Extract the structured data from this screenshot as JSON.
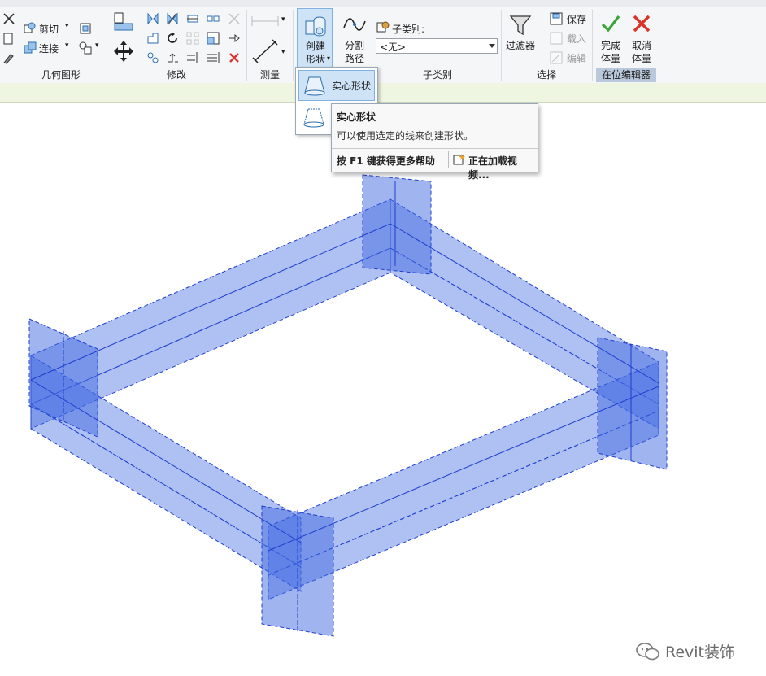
{
  "ribbon": {
    "geometry": {
      "cut_label": "剪切",
      "join_label": "连接",
      "panel_label": "几何图形"
    },
    "modify": {
      "panel_label": "修改"
    },
    "measure": {
      "panel_label": "测量"
    },
    "create": {
      "create_shape_label_line1": "创建",
      "create_shape_label_line2": "形状",
      "split_path_label_line1": "分割",
      "split_path_label_line2": "路径"
    },
    "subcategory": {
      "field_label": "子类别:",
      "selected_value": "<无>",
      "panel_label": "子类别"
    },
    "select": {
      "filter_label": "过滤器",
      "panel_label": "选择"
    },
    "family": {
      "save_label": "保存",
      "load_label": "载入",
      "edit_label": "编辑"
    },
    "in_place_editor": {
      "finish_label_line1": "完成",
      "finish_label_line2": "体量",
      "cancel_label_line1": "取消",
      "cancel_label_line2": "体量",
      "panel_label": "在位编辑器"
    }
  },
  "dropdown": {
    "solid_form_label": "实心形状",
    "void_form_label": "空"
  },
  "tooltip": {
    "title": "实心形状",
    "description": "可以使用选定的线来创建形状。",
    "help_text": "按 F1 键获得更多帮助",
    "video_text": "正在加载视频..."
  },
  "watermark": {
    "text": "Revit装饰"
  },
  "colors": {
    "ribbon_bg": "#f5f6f7",
    "highlight": "#cfe3f7",
    "highlight_border": "#7fb1e3",
    "model_fill": "#4169e1",
    "model_edge": "#1f3fd0",
    "finish_green": "#3aa63a",
    "cancel_red": "#d9322b"
  }
}
